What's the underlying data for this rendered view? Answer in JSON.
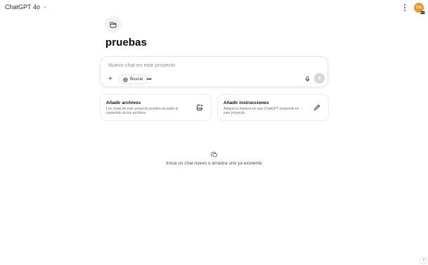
{
  "header": {
    "model_name": "ChatGPT 4o",
    "avatar_initials": "CA",
    "avatar_badge": "PLUS"
  },
  "project": {
    "title": "pruebas"
  },
  "composer": {
    "placeholder": "Nuevo chat en este proyecto",
    "search_label": "Buscar"
  },
  "cards": {
    "files": {
      "title": "Añadir archivos",
      "description": "Los chats de este proyecto pueden acceder al contenido de los archivos"
    },
    "instructions": {
      "title": "Añadir instrucciones",
      "description": "Adapta la manera en que ChatGPT responde en este proyecto"
    }
  },
  "empty_state": {
    "text": "Inicia un chat nuevo o arrastra uno ya existente"
  },
  "help": {
    "label": "?"
  },
  "colors": {
    "avatar": "#e79a2b",
    "send_disabled": "#d7d7d7"
  }
}
